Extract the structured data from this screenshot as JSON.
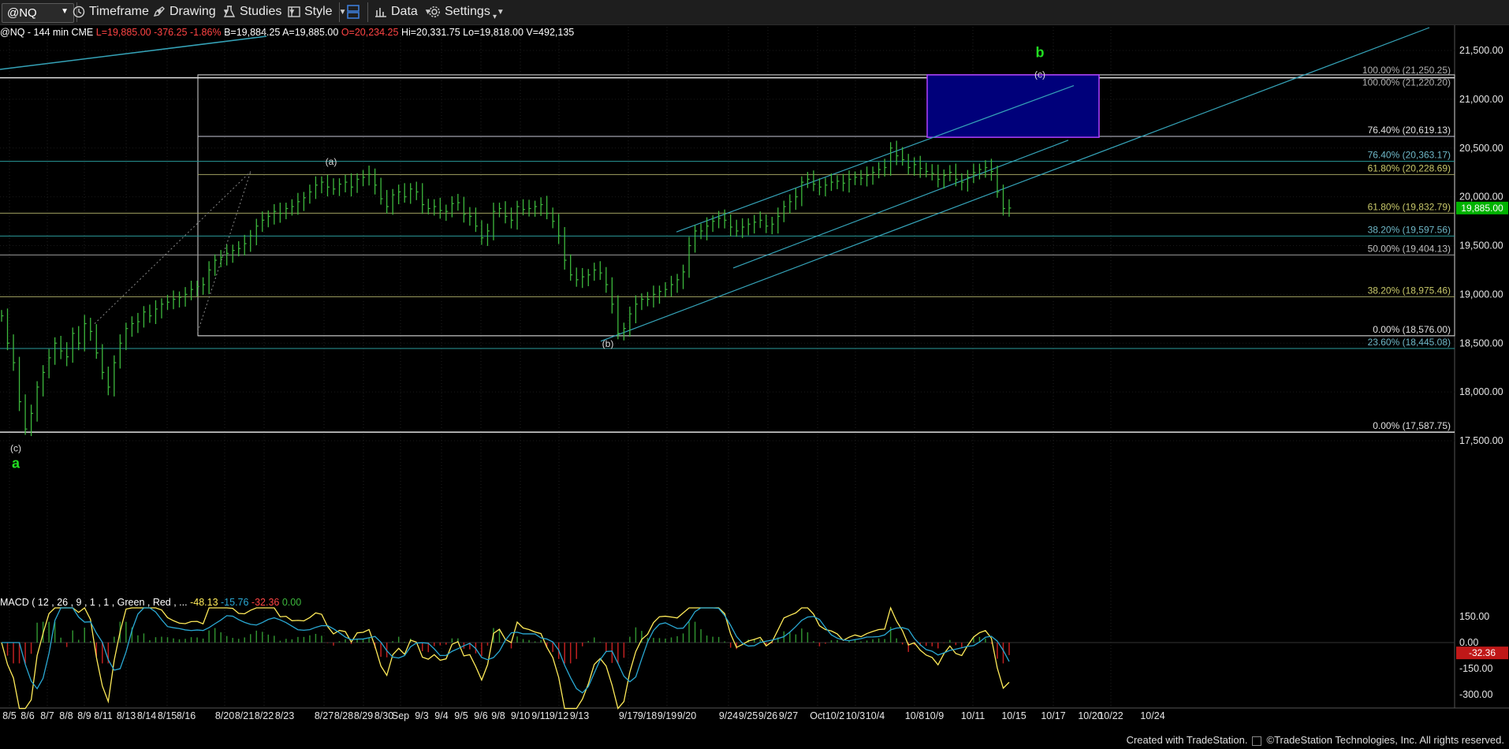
{
  "toolbar": {
    "symbol": "@NQ",
    "timeframe_label": "Timeframe",
    "drawing_label": "Drawing",
    "studies_label": "Studies",
    "style_label": "Style",
    "data_label": "Data",
    "settings_label": "Settings"
  },
  "status": {
    "symbol_desc": "@NQ - 144 min  CME",
    "last": "L=19,885.00",
    "chg": "-376.25",
    "pct": "-1.86%",
    "bid": "B=19,884.25",
    "ask": "A=19,885.00",
    "open": "O=20,234.25",
    "high": "Hi=20,331.75",
    "low": "Lo=19,818.00",
    "volume": "V=492,135"
  },
  "macd": {
    "title": "MACD ( 12 , 26 , 9 , 1 , 1 , Green , Red , ...",
    "v1": "-48.13",
    "v2": "-15.76",
    "v3": "-32.36",
    "v4": "0.00"
  },
  "footer": {
    "created_with": "Created with TradeStation.",
    "copyright": "©TradeStation Technologies, Inc. All rights reserved."
  },
  "colors": {
    "background": "#000000",
    "price_bars": "#3db83d",
    "channel": "#35a3b8",
    "target_box": "#00007a",
    "target_box_border": "#b040ff",
    "wave_label_green": "#22dd22",
    "last_price_tag": "#00b300",
    "macd_line": "#ffeb59",
    "signal_line": "#2aa9d4",
    "hist_pos": "#2f8f2f",
    "hist_neg": "#c02020"
  },
  "chart_data": {
    "type": "line",
    "title": "@NQ - 144 min",
    "price_axis": {
      "ylim": [
        16900,
        21800
      ],
      "ticks": [
        "21,500.00",
        "21,000.00",
        "20,500.00",
        "20,000.00",
        "19,500.00",
        "19,000.00",
        "18,500.00",
        "18,000.00",
        "17,500.00"
      ],
      "tick_values": [
        21500,
        21000,
        20500,
        20000,
        19500,
        19000,
        18500,
        18000,
        17500
      ],
      "last_price": 19885,
      "last_price_label": "19,885.00"
    },
    "x_axis": {
      "labels": [
        "8/5",
        "8/6",
        "8/7",
        "8/8",
        "8/9",
        "8/11",
        "8/13",
        "8/14",
        "8/15",
        "8/16",
        "8/20",
        "8/21",
        "8/22",
        "8/23",
        "8/27",
        "8/28",
        "8/29",
        "8/30",
        "Sep",
        "9/3",
        "9/4",
        "9/5",
        "9/6",
        "9/8",
        "9/10",
        "9/11",
        "9/12",
        "9/13",
        "9/17",
        "9/18",
        "9/19",
        "9/20",
        "9/24",
        "9/25",
        "9/26",
        "9/27",
        "Oct",
        "10/2",
        "10/3",
        "10/4",
        "10/8",
        "10/9",
        "10/11",
        "10/15",
        "10/17",
        "10/20",
        "10/22",
        "10/24"
      ]
    },
    "series": [
      {
        "kind": "ohlc-close",
        "x": [
          0,
          2,
          4,
          6,
          8,
          10,
          12,
          14,
          16,
          18,
          20,
          22,
          24,
          26,
          28,
          30,
          32,
          34,
          36,
          38,
          40,
          42,
          44,
          46,
          48,
          50,
          52,
          54,
          56,
          58,
          60,
          62,
          64,
          66,
          68,
          70,
          72,
          74,
          76,
          78,
          80,
          82,
          84,
          86,
          88,
          90,
          92,
          94,
          96,
          98,
          100,
          102,
          104,
          106,
          108,
          110,
          112,
          114,
          116,
          118,
          120,
          122,
          124,
          126,
          128,
          130,
          132,
          134,
          136,
          138,
          140,
          142,
          144,
          146,
          148,
          150,
          152,
          154,
          156,
          158,
          160,
          162,
          164,
          166,
          168,
          170,
          172,
          174,
          176,
          178,
          180,
          182,
          184,
          186,
          188,
          190,
          192,
          194,
          196,
          198,
          200,
          202,
          204,
          206,
          208,
          210,
          212,
          214,
          216,
          218,
          220,
          222,
          224,
          226,
          228,
          230,
          232,
          234,
          236,
          238,
          240,
          242,
          244,
          246,
          248,
          250,
          252,
          254,
          256,
          258,
          260,
          262,
          264,
          266,
          268,
          270,
          272,
          274,
          276,
          278,
          280,
          282,
          284,
          286,
          288,
          290,
          292,
          294,
          296,
          298,
          300,
          302,
          304,
          306,
          308,
          310,
          312,
          314,
          316,
          318,
          320,
          322,
          324,
          326,
          328,
          330,
          332,
          334,
          336,
          338,
          340,
          342,
          344,
          346,
          348,
          350,
          352,
          354,
          356,
          358,
          360,
          362,
          364,
          366,
          368,
          370,
          372,
          374,
          376,
          378,
          380,
          382,
          384,
          386,
          388,
          390,
          392,
          394,
          396,
          398,
          400,
          402,
          404,
          406,
          408,
          410,
          412,
          414,
          416,
          418,
          420,
          422,
          424,
          426,
          428,
          430,
          432,
          434,
          436,
          438,
          440,
          442,
          444,
          446,
          448,
          450,
          452,
          454,
          456,
          458,
          460,
          462,
          464,
          466,
          468,
          470,
          472,
          474,
          476,
          478,
          480,
          482,
          484,
          486,
          488,
          490,
          492,
          494,
          496,
          498,
          500,
          502,
          504,
          506,
          508,
          510
        ],
        "close": [
          18780,
          18500,
          18300,
          17900,
          17620,
          17780,
          18050,
          18200,
          18350,
          18500,
          18420,
          18360,
          18600,
          18500,
          18700,
          18620,
          18400,
          18200,
          18050,
          18300,
          18500,
          18650,
          18700,
          18720,
          18820,
          18780,
          18850,
          18900,
          18920,
          18950,
          18970,
          19000,
          19050,
          19080,
          19100,
          19250,
          19350,
          19380,
          19420,
          19450,
          19470,
          19520,
          19600,
          19700,
          19760,
          19800,
          19850,
          19830,
          19880,
          19900,
          19950,
          19990,
          20050,
          20120,
          20150,
          20100,
          20080,
          20130,
          20150,
          20100,
          20180,
          20200,
          20230,
          20120,
          19980,
          19900,
          20020,
          20050,
          20000,
          20080,
          20050,
          19920,
          19880,
          19900,
          19860,
          19850,
          19930,
          19940,
          19820,
          19800,
          19700,
          19580,
          19650,
          19850,
          19880,
          19800,
          19760,
          19900,
          19870,
          19880,
          19900,
          19920,
          19830,
          19750,
          19600,
          19350,
          19200,
          19150,
          19180,
          19200,
          19250,
          19220,
          19100,
          18900,
          18600,
          18650,
          18800,
          18900,
          18950,
          18950,
          19000,
          19030,
          19050,
          19100,
          19150,
          19230,
          19500,
          19650,
          19650,
          19700,
          19750,
          19780,
          19760,
          19690,
          19650,
          19690,
          19720,
          19740,
          19760,
          19700,
          19720,
          19800,
          19900,
          19950,
          20000,
          20150,
          20180,
          20130,
          20100,
          20120,
          20150,
          20160,
          20140,
          20180,
          20200,
          20190,
          20220,
          20250,
          20280,
          20300,
          20500,
          20420,
          20380,
          20300,
          20330,
          20290,
          20260,
          20240,
          20180,
          20220,
          20250,
          20180,
          20150,
          20200,
          20250,
          20280,
          20300,
          20260,
          20050,
          19880,
          19885
        ]
      }
    ],
    "horizontal_levels": [
      {
        "label": "100.00% (21,250.25)",
        "value": 21250.25
      },
      {
        "label": "100.00% (21,220.20)",
        "value": 21220.2
      },
      {
        "label": "76.40% (20,619.13)",
        "value": 20619.13
      },
      {
        "label": "76.40% (20,363.17)",
        "value": 20363.17
      },
      {
        "label": "61.80% (20,228.69)",
        "value": 20228.69
      },
      {
        "label": "61.80% (19,832.79)",
        "value": 19832.79
      },
      {
        "label": "38.20% (19,597.56)",
        "value": 19597.56
      },
      {
        "label": "50.00% (19,404.13)",
        "value": 19404.13
      },
      {
        "label": "38.20% (18,975.46)",
        "value": 18975.46
      },
      {
        "label": "0.00% (18,576.00)",
        "value": 18576.0
      },
      {
        "label": "23.60% (18,445.08)",
        "value": 18445.08
      },
      {
        "label": "0.00% (17,587.75)",
        "value": 17587.75
      }
    ],
    "wave_labels": [
      {
        "text": "(a)",
        "value": 20330
      },
      {
        "text": "(b)",
        "value": 18460
      },
      {
        "text": "(c)",
        "value": 21220
      },
      {
        "text": "b",
        "value": 21430
      },
      {
        "text": "(c)",
        "value": 17390
      },
      {
        "text": "a",
        "value": 17220
      }
    ],
    "target_box": {
      "low": 20610,
      "high": 21250
    },
    "macd": {
      "ticks": [
        "150.00",
        "0.00",
        "-150.00",
        "-300.00"
      ],
      "tick_values": [
        150,
        0,
        -150,
        -300
      ],
      "ylim": [
        -390,
        210
      ],
      "last_label": "-32.36"
    }
  }
}
